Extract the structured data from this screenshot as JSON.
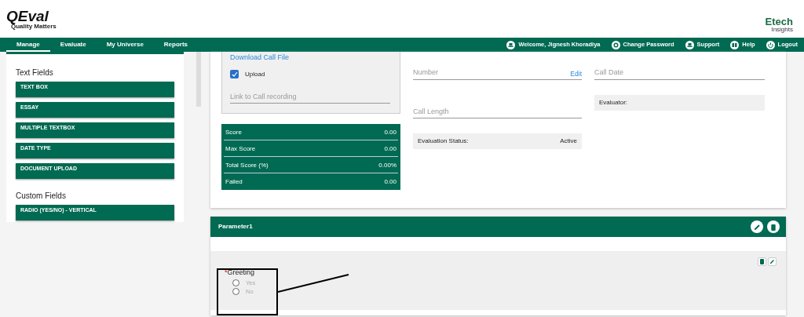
{
  "header": {
    "logo": {
      "mark": "QEval",
      "tagline": "Quality Matters"
    },
    "partner_logo": {
      "name": "Etech",
      "sub": "Insights"
    }
  },
  "nav": {
    "tabs": [
      {
        "label": "Manage",
        "selected": true
      },
      {
        "label": "Evaluate",
        "selected": false
      },
      {
        "label": "My Universe",
        "selected": false
      },
      {
        "label": "Reports",
        "selected": false
      }
    ],
    "links": [
      {
        "label": "Welcome, Jignesh Khoradiya",
        "kind": "user"
      },
      {
        "label": "Change Password",
        "kind": "gear"
      },
      {
        "label": "Support",
        "kind": "user"
      },
      {
        "label": "Help",
        "kind": "book"
      },
      {
        "label": "Logout",
        "kind": "power"
      }
    ]
  },
  "sidebar": {
    "groups": [
      {
        "title": "Text Fields",
        "items": [
          "TEXT BOX",
          "ESSAY",
          "MULTIPLE TEXTBOX",
          "DATE TYPE",
          "DOCUMENT UPLOAD"
        ]
      },
      {
        "title": "Custom Fields",
        "items": [
          "RADIO (YES/NO) - VERTICAL"
        ]
      }
    ]
  },
  "call": {
    "download_link": "Download Call File",
    "upload": {
      "label": "Upload",
      "checked": true
    },
    "link_field": {
      "placeholder": "Link to Call recording"
    }
  },
  "scores": [
    {
      "label": "Score",
      "value": "0.00"
    },
    {
      "label": "Max Score",
      "value": "0.00"
    },
    {
      "label": "Total Score (%)",
      "value": "0.00%"
    },
    {
      "label": "Failed",
      "value": "0.00"
    }
  ],
  "fields": {
    "number": {
      "placeholder": "Number",
      "action": "Edit"
    },
    "call_length": {
      "placeholder": "Call Length"
    },
    "evaluation_status": {
      "label": "Evaluation Status:",
      "value": "Active"
    },
    "call_date": {
      "placeholder": "Call Date"
    },
    "evaluator": {
      "label": "Evaluator:"
    }
  },
  "parameter": {
    "title": "Parameter1",
    "question": {
      "marker": "*",
      "label": "Greeting",
      "options": [
        {
          "label": "Yes",
          "selected": false
        },
        {
          "label": "No",
          "selected": false
        }
      ]
    }
  }
}
